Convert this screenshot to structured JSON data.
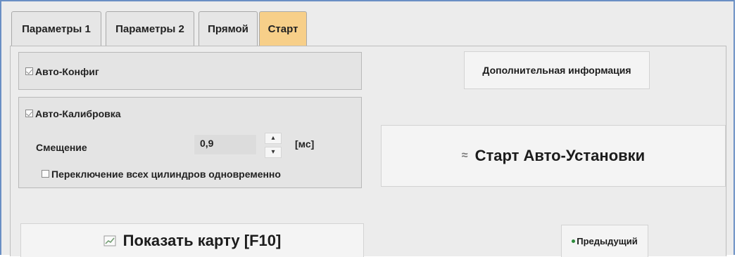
{
  "tabs": [
    {
      "label": "Параметры 1",
      "active": false
    },
    {
      "label": "Параметры 2",
      "active": false
    },
    {
      "label": "Прямой",
      "active": false
    },
    {
      "label": "Старт",
      "active": true
    }
  ],
  "auto_config": {
    "label": "Авто-Конфиг",
    "checked": true
  },
  "auto_calibration": {
    "label": "Авто-Калибровка",
    "checked": true,
    "offset_label": "Смещение",
    "offset_value": "0,9",
    "unit": "[мс]",
    "switch_all_label": "Переключение всех цилиндров одновременно",
    "switch_all_checked": false
  },
  "buttons": {
    "additional_info": "Дополнительная информация",
    "start_auto_setup": "Старт Авто-Установки",
    "show_map": "Показать карту [F10]",
    "previous": "Предыдущий"
  },
  "colors": {
    "active_tab": "#f7cf89",
    "frame_border": "#6a8fc4",
    "previous_icon": "#2e8b3c"
  }
}
